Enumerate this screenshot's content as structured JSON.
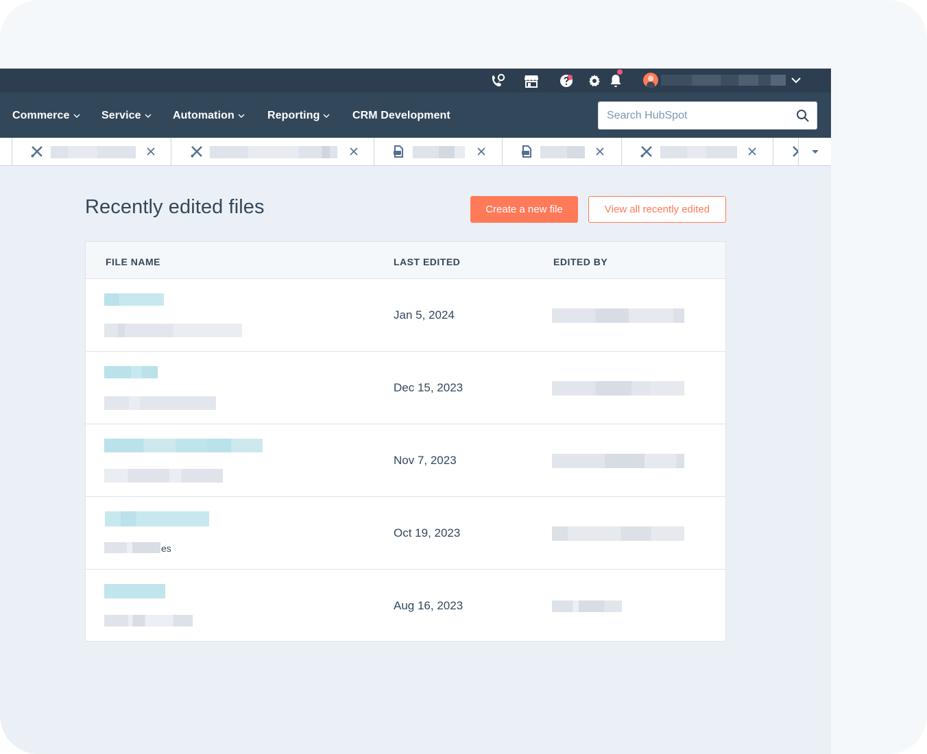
{
  "nav": {
    "items": [
      {
        "label": "Commerce",
        "has_dropdown": true
      },
      {
        "label": "Service",
        "has_dropdown": true
      },
      {
        "label": "Automation",
        "has_dropdown": true
      },
      {
        "label": "Reporting",
        "has_dropdown": true
      },
      {
        "label": "CRM Development",
        "has_dropdown": false
      }
    ],
    "search_placeholder": "Search HubSpot"
  },
  "topbar": {
    "icons": [
      "calling-icon",
      "marketplace-icon",
      "help-icon",
      "settings-icon",
      "notifications-icon"
    ],
    "notification_dot_color": "#f2547d"
  },
  "tabs": [
    {
      "icon": "tools-icon",
      "label": "[blurred]"
    },
    {
      "icon": "tools-icon",
      "label": "[blurred]"
    },
    {
      "icon": "file-icon",
      "label": "[blurred]"
    },
    {
      "icon": "file-icon",
      "label": "[blurred]"
    },
    {
      "icon": "tools-icon",
      "label": "[blurred]"
    }
  ],
  "page": {
    "title": "Recently edited files",
    "create_button": "Create a new file",
    "view_all_button": "View all recently edited"
  },
  "table": {
    "columns": [
      "FILE NAME",
      "LAST EDITED",
      "EDITED BY"
    ],
    "rows": [
      {
        "file_name": "[blurred]",
        "file_subtext": "[blurred]",
        "last_edited": "Jan 5, 2024",
        "edited_by": "[blurred]"
      },
      {
        "file_name": "[blurred]",
        "file_subtext": "[blurred]",
        "last_edited": "Dec 15, 2023",
        "edited_by": "[blurred]"
      },
      {
        "file_name": "[blurred]",
        "file_subtext": "[blurred]",
        "last_edited": "Nov 7, 2023",
        "edited_by": "[blurred]"
      },
      {
        "file_name": "[blurred]",
        "file_subtext_visible_suffix": "es",
        "last_edited": "Oct 19, 2023",
        "edited_by": "[blurred]"
      },
      {
        "file_name": "[blurred]",
        "file_subtext": "[blurred]",
        "last_edited": "Aug 16, 2023",
        "edited_by": "[blurred]"
      }
    ]
  },
  "colors": {
    "topbar_bg": "#2d3e50",
    "navbar_bg": "#33475b",
    "accent": "#ff7a59",
    "content_bg": "#ebf0f6",
    "link_blur": "#b9e2ea"
  }
}
